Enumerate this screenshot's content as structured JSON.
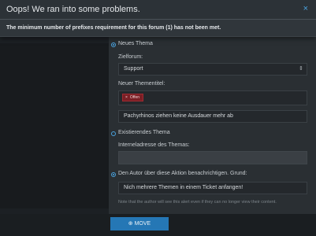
{
  "error": {
    "title": "Oops! We ran into some problems.",
    "close_icon": "×",
    "message": "The minimum number of prefixes requirement for this forum (1) has not been met."
  },
  "form": {
    "new_thread_option": "Neues Thema",
    "target_forum_label": "Zielforum:",
    "target_forum_value": "Support",
    "new_title_label": "Neuer Thementitel:",
    "prefix_tag": "Offen",
    "prefix_remove": "×",
    "title_value": "Pachyrhinos ziehen keine Ausdauer mehr ab",
    "existing_thread_option": "Existierendes Thema",
    "thread_url_label": "Interneladresse des Themas:",
    "thread_url_value": "",
    "notify_label": "Den Autor über diese Aktion benachrichtigen. Grund:",
    "reason_value": "Nich mehrere Themen in einem Ticket anfangen!",
    "note": "Note that the author will see this alert even if they can no longer view their content."
  },
  "footer": {
    "move_button": "⊕ MOVE"
  },
  "colors": {
    "accent": "#4aa3df",
    "button": "#2577b5",
    "tag_bg": "#7a1f25"
  }
}
